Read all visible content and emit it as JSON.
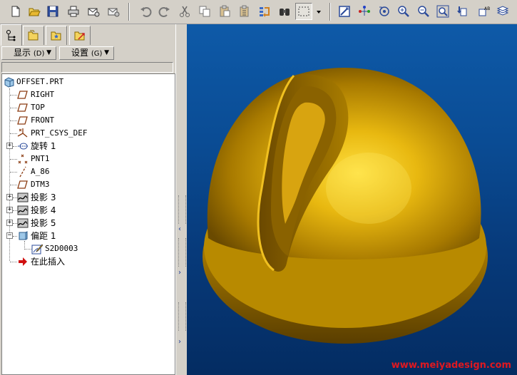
{
  "menus": {
    "display": "显示",
    "display_key": "(D)",
    "settings": "设置",
    "settings_key": "(G)"
  },
  "tree": {
    "root": "OFFSET.PRT",
    "items": [
      {
        "label": "RIGHT"
      },
      {
        "label": "TOP"
      },
      {
        "label": "FRONT"
      },
      {
        "label": "PRT_CSYS_DEF"
      },
      {
        "label": "旋转 1"
      },
      {
        "label": "PNT1"
      },
      {
        "label": "A_86"
      },
      {
        "label": "DTM3"
      },
      {
        "label": "投影 3"
      },
      {
        "label": "投影 4"
      },
      {
        "label": "投影 5"
      },
      {
        "label": "偏距 1"
      },
      {
        "label": "S2D0003"
      },
      {
        "label": "在此插入"
      }
    ]
  },
  "viewport": {
    "background": "#0a4b93",
    "model_color": "#c8960a"
  },
  "watermark": "www.meiyadesign.com",
  "icons": {
    "toolbar": [
      "new-icon",
      "open-icon",
      "save-icon",
      "print-icon",
      "email-icon",
      "email-attach-icon",
      "undo-icon",
      "redo-icon",
      "cut-icon",
      "copy-icon",
      "paste-icon",
      "paste-special-icon",
      "regenerate-icon",
      "find-icon",
      "select-box-icon",
      "repaint-icon",
      "spin-center-icon",
      "orient-icon",
      "zoom-in-icon",
      "zoom-out-icon",
      "refit-icon",
      "reorient-icon",
      "saved-views-icon",
      "layers-icon"
    ]
  }
}
